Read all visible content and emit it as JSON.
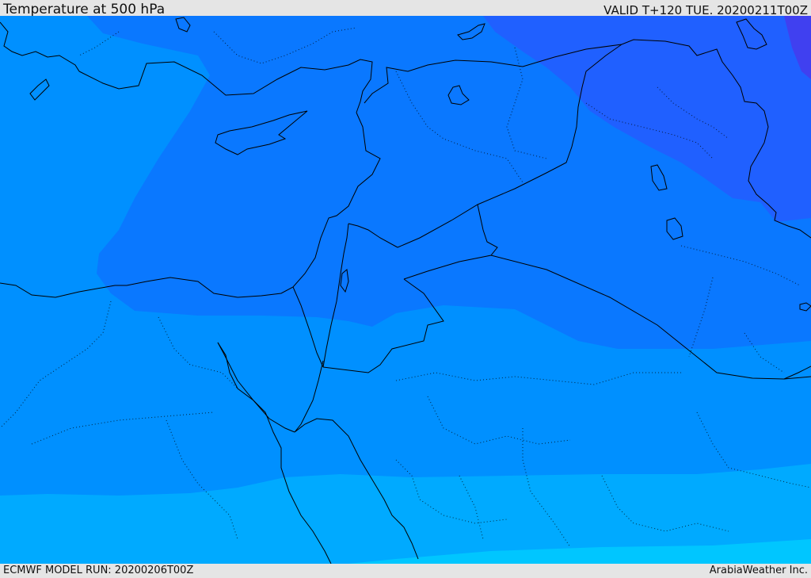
{
  "header": {
    "title": "Temperature at 500 hPa",
    "valid": "VALID T+120 TUE. 20200211T00Z"
  },
  "footer": {
    "model_run": "ECMWF MODEL RUN: 20200206T00Z",
    "credit": "ArabiaWeather Inc."
  },
  "map": {
    "parameter": "temperature",
    "level": "500 hPa",
    "colors": {
      "band_coldest": "#4040f0",
      "band_cold": "#2060ff",
      "band_mid": "#0a78ff",
      "band_warm": "#0090ff",
      "band_warmer": "#00aaff",
      "band_warmest": "#00c6ff",
      "coastline": "#000000",
      "border": "#000000"
    }
  }
}
